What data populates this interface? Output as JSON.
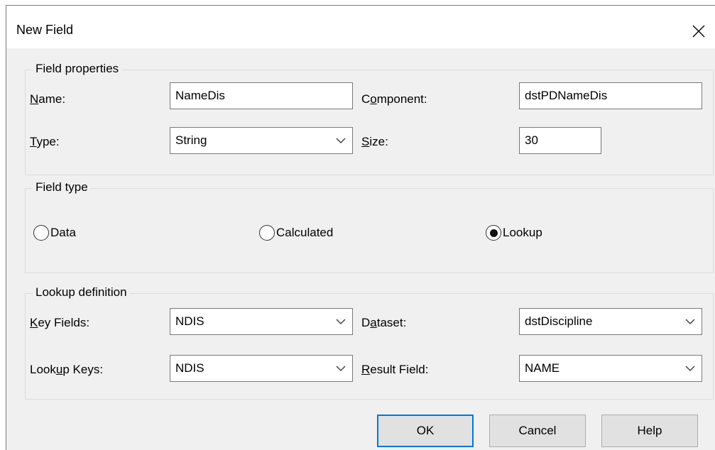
{
  "dialog": {
    "title": "New Field",
    "close_icon": "close-icon"
  },
  "field_properties": {
    "legend": "Field properties",
    "name_label": "Name:",
    "name_value": "NameDis",
    "component_label": "Component:",
    "component_value": "dstPDNameDis",
    "type_label": "Type:",
    "type_value": "String",
    "size_label": "Size:",
    "size_value": "30"
  },
  "field_type": {
    "legend": "Field type",
    "options": [
      {
        "label": "Data",
        "selected": false
      },
      {
        "label": "Calculated",
        "selected": false
      },
      {
        "label": "Lookup",
        "selected": true
      }
    ]
  },
  "lookup_definition": {
    "legend": "Lookup definition",
    "key_fields_label": "Key Fields:",
    "key_fields_value": "NDIS",
    "dataset_label": "Dataset:",
    "dataset_value": "dstDiscipline",
    "lookup_keys_label": "Lookup Keys:",
    "lookup_keys_value": "NDIS",
    "result_field_label": "Result Field:",
    "result_field_value": "NAME"
  },
  "buttons": {
    "ok": "OK",
    "cancel": "Cancel",
    "help": "Help"
  },
  "colors": {
    "dialog_bg": "#f0f0f0",
    "default_button_border": "#0078d7"
  }
}
